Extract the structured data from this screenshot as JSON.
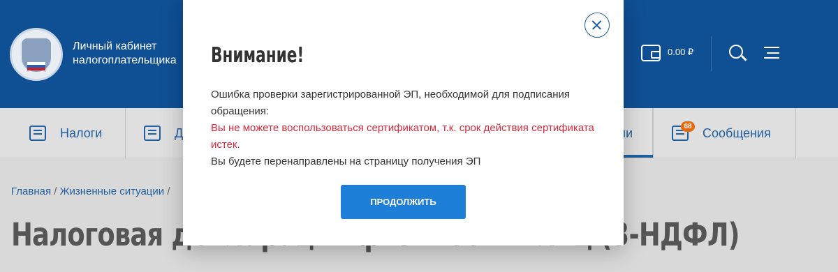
{
  "header": {
    "title_line1": "Личный кабинет",
    "title_line2": "налогоплательщика",
    "balance": "0.00 ₽"
  },
  "nav": {
    "items": [
      {
        "label": "Налоги",
        "icon": "taxes-icon"
      },
      {
        "label": "Д",
        "icon": "documents-icon"
      },
      {
        "label": "ии",
        "icon": ""
      },
      {
        "label": "Сообщения",
        "icon": "messages-icon"
      }
    ],
    "messages_badge": "68"
  },
  "breadcrumb": {
    "home": "Главная",
    "separator": " / ",
    "situations": "Жизненные ситуации",
    "tail": "/"
  },
  "page_title": "Налоговая декларация физических лиц (3-НДФЛ)",
  "modal": {
    "title": "Внимание!",
    "line1": "Ошибка проверки зарегистрированной ЭП, необходимой для подписания обращения:",
    "error": "Вы не можете воспользоваться сертификатом, т.к. срок действия сертификата истек.",
    "line3": "Вы будете перенаправлены на страницу получения ЭП",
    "button": "ПРОДОЛЖИТЬ"
  },
  "colors": {
    "header_bg": "#0f4f94",
    "accent": "#1e7fd8",
    "error": "#d62a3c",
    "badge": "#e86a0f"
  }
}
